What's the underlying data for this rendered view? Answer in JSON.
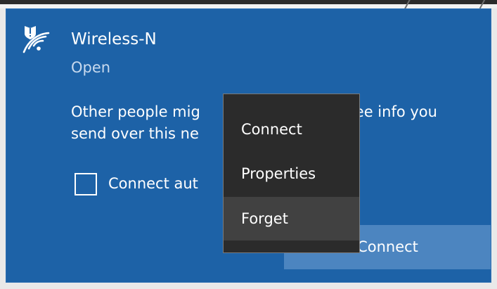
{
  "network": {
    "name": "Wireless-N",
    "status": "Open",
    "warning_line1": "Other people mig",
    "warning_line1b": "ee info you",
    "warning_line2": "send over this ne",
    "connect_automatically": "Connect aut",
    "connect_button": "Connect"
  },
  "context_menu": {
    "items": [
      {
        "label": "Connect"
      },
      {
        "label": "Properties"
      },
      {
        "label": "Forget"
      }
    ]
  },
  "colors": {
    "panel": "#1d62a7",
    "menu": "#2b2b2b",
    "menu_hover": "#414141",
    "button": "#4c85c0"
  },
  "icons": {
    "network": "wifi-shield-warning-icon"
  }
}
